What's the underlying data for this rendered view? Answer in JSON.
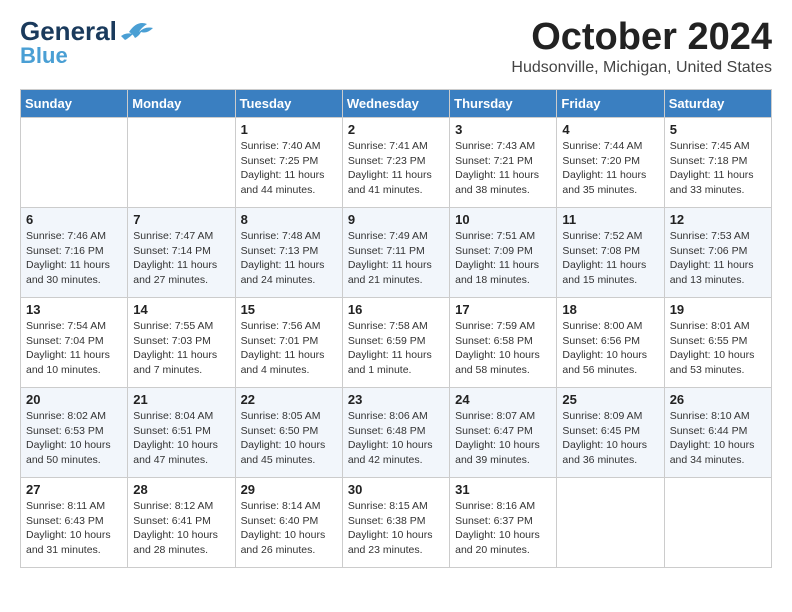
{
  "header": {
    "logo_line1": "General",
    "logo_line2": "Blue",
    "month": "October 2024",
    "location": "Hudsonville, Michigan, United States"
  },
  "weekdays": [
    "Sunday",
    "Monday",
    "Tuesday",
    "Wednesday",
    "Thursday",
    "Friday",
    "Saturday"
  ],
  "weeks": [
    [
      {
        "day": "",
        "info": ""
      },
      {
        "day": "",
        "info": ""
      },
      {
        "day": "1",
        "info": "Sunrise: 7:40 AM\nSunset: 7:25 PM\nDaylight: 11 hours and 44 minutes."
      },
      {
        "day": "2",
        "info": "Sunrise: 7:41 AM\nSunset: 7:23 PM\nDaylight: 11 hours and 41 minutes."
      },
      {
        "day": "3",
        "info": "Sunrise: 7:43 AM\nSunset: 7:21 PM\nDaylight: 11 hours and 38 minutes."
      },
      {
        "day": "4",
        "info": "Sunrise: 7:44 AM\nSunset: 7:20 PM\nDaylight: 11 hours and 35 minutes."
      },
      {
        "day": "5",
        "info": "Sunrise: 7:45 AM\nSunset: 7:18 PM\nDaylight: 11 hours and 33 minutes."
      }
    ],
    [
      {
        "day": "6",
        "info": "Sunrise: 7:46 AM\nSunset: 7:16 PM\nDaylight: 11 hours and 30 minutes."
      },
      {
        "day": "7",
        "info": "Sunrise: 7:47 AM\nSunset: 7:14 PM\nDaylight: 11 hours and 27 minutes."
      },
      {
        "day": "8",
        "info": "Sunrise: 7:48 AM\nSunset: 7:13 PM\nDaylight: 11 hours and 24 minutes."
      },
      {
        "day": "9",
        "info": "Sunrise: 7:49 AM\nSunset: 7:11 PM\nDaylight: 11 hours and 21 minutes."
      },
      {
        "day": "10",
        "info": "Sunrise: 7:51 AM\nSunset: 7:09 PM\nDaylight: 11 hours and 18 minutes."
      },
      {
        "day": "11",
        "info": "Sunrise: 7:52 AM\nSunset: 7:08 PM\nDaylight: 11 hours and 15 minutes."
      },
      {
        "day": "12",
        "info": "Sunrise: 7:53 AM\nSunset: 7:06 PM\nDaylight: 11 hours and 13 minutes."
      }
    ],
    [
      {
        "day": "13",
        "info": "Sunrise: 7:54 AM\nSunset: 7:04 PM\nDaylight: 11 hours and 10 minutes."
      },
      {
        "day": "14",
        "info": "Sunrise: 7:55 AM\nSunset: 7:03 PM\nDaylight: 11 hours and 7 minutes."
      },
      {
        "day": "15",
        "info": "Sunrise: 7:56 AM\nSunset: 7:01 PM\nDaylight: 11 hours and 4 minutes."
      },
      {
        "day": "16",
        "info": "Sunrise: 7:58 AM\nSunset: 6:59 PM\nDaylight: 11 hours and 1 minute."
      },
      {
        "day": "17",
        "info": "Sunrise: 7:59 AM\nSunset: 6:58 PM\nDaylight: 10 hours and 58 minutes."
      },
      {
        "day": "18",
        "info": "Sunrise: 8:00 AM\nSunset: 6:56 PM\nDaylight: 10 hours and 56 minutes."
      },
      {
        "day": "19",
        "info": "Sunrise: 8:01 AM\nSunset: 6:55 PM\nDaylight: 10 hours and 53 minutes."
      }
    ],
    [
      {
        "day": "20",
        "info": "Sunrise: 8:02 AM\nSunset: 6:53 PM\nDaylight: 10 hours and 50 minutes."
      },
      {
        "day": "21",
        "info": "Sunrise: 8:04 AM\nSunset: 6:51 PM\nDaylight: 10 hours and 47 minutes."
      },
      {
        "day": "22",
        "info": "Sunrise: 8:05 AM\nSunset: 6:50 PM\nDaylight: 10 hours and 45 minutes."
      },
      {
        "day": "23",
        "info": "Sunrise: 8:06 AM\nSunset: 6:48 PM\nDaylight: 10 hours and 42 minutes."
      },
      {
        "day": "24",
        "info": "Sunrise: 8:07 AM\nSunset: 6:47 PM\nDaylight: 10 hours and 39 minutes."
      },
      {
        "day": "25",
        "info": "Sunrise: 8:09 AM\nSunset: 6:45 PM\nDaylight: 10 hours and 36 minutes."
      },
      {
        "day": "26",
        "info": "Sunrise: 8:10 AM\nSunset: 6:44 PM\nDaylight: 10 hours and 34 minutes."
      }
    ],
    [
      {
        "day": "27",
        "info": "Sunrise: 8:11 AM\nSunset: 6:43 PM\nDaylight: 10 hours and 31 minutes."
      },
      {
        "day": "28",
        "info": "Sunrise: 8:12 AM\nSunset: 6:41 PM\nDaylight: 10 hours and 28 minutes."
      },
      {
        "day": "29",
        "info": "Sunrise: 8:14 AM\nSunset: 6:40 PM\nDaylight: 10 hours and 26 minutes."
      },
      {
        "day": "30",
        "info": "Sunrise: 8:15 AM\nSunset: 6:38 PM\nDaylight: 10 hours and 23 minutes."
      },
      {
        "day": "31",
        "info": "Sunrise: 8:16 AM\nSunset: 6:37 PM\nDaylight: 10 hours and 20 minutes."
      },
      {
        "day": "",
        "info": ""
      },
      {
        "day": "",
        "info": ""
      }
    ]
  ]
}
